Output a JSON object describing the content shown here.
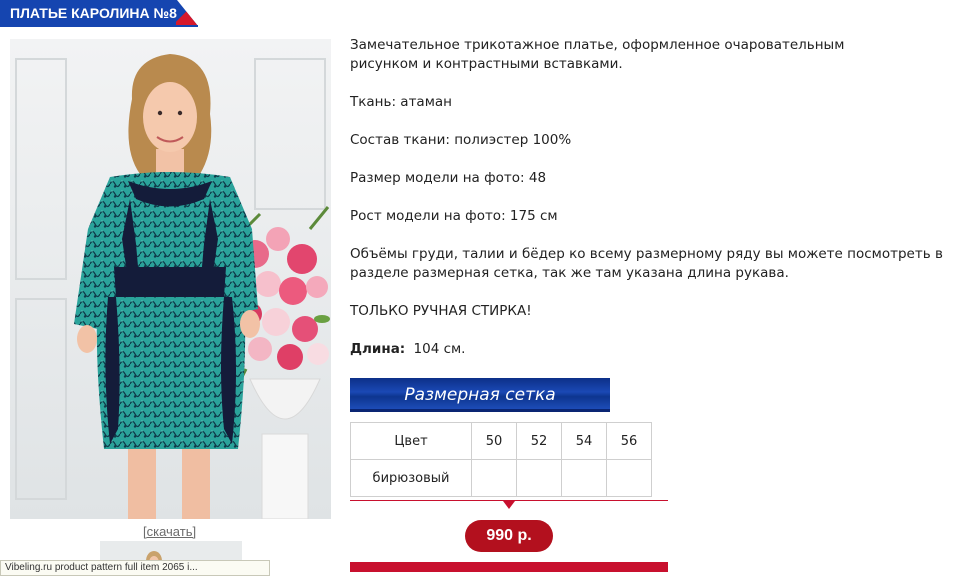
{
  "header": {
    "title": "ПЛАТЬЕ КАРОЛИНА №8"
  },
  "photo": {
    "download_label": "[скачать]"
  },
  "tooltip": {
    "text": "Vibeling.ru product pattern full item 2065 i..."
  },
  "description": {
    "intro": "Замечательное трикотажное платье, оформленное очаровательным рисунком и контрастными вставками.",
    "fabric": "Ткань: атаман",
    "composition": "Состав ткани: полиэстер 100%",
    "model_size": "Размер модели на фото: 48",
    "model_height": "Рост модели на фото: 175 см",
    "measurements": "Объёмы груди, талии и бёдер ко всему размерному ряду вы можете посмотреть в разделе размерная сетка, так же там указана длина рукава.",
    "hand_wash": "ТОЛЬКО РУЧНАЯ СТИРКА!",
    "length_label": "Длина:",
    "length_value": "104 см."
  },
  "size_chart_button": {
    "label": "Размерная сетка"
  },
  "sizes_table": {
    "color_header": "Цвет",
    "sizes": [
      "50",
      "52",
      "54",
      "56"
    ],
    "rows": [
      {
        "color": "бирюзовый",
        "cells": [
          "",
          "",
          "",
          ""
        ]
      }
    ]
  },
  "price": {
    "value": "990 р."
  },
  "colors": {
    "blue": "#1545b0",
    "red": "#c8102e",
    "dress": "#2aa39b",
    "panel": "#141c3a"
  }
}
